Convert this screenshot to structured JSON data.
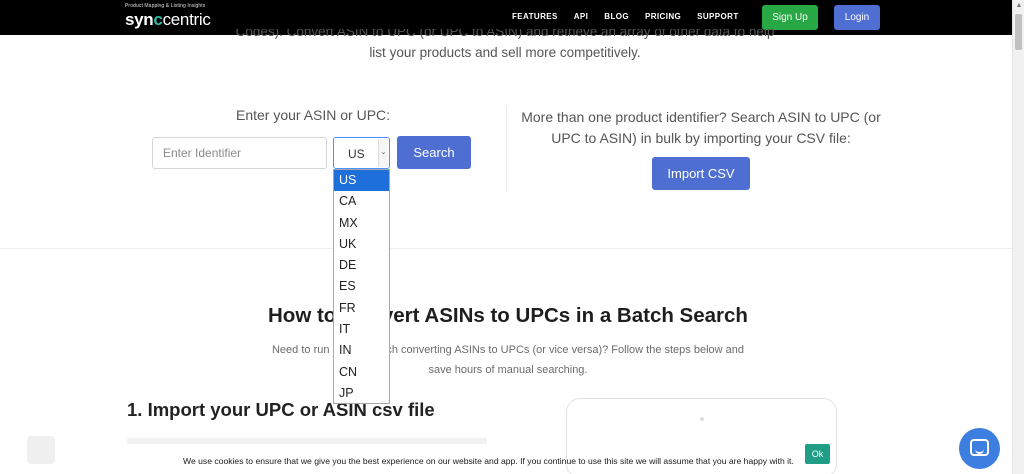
{
  "header": {
    "logo_tagline": "Product Mapping & Listing Insights",
    "logo_text_start": "syn",
    "logo_text_o": "c",
    "logo_text_end": "centric",
    "nav": [
      "FEATURES",
      "API",
      "BLOG",
      "PRICING",
      "SUPPORT"
    ],
    "signup_label": "Sign Up",
    "login_label": "Login"
  },
  "intro": {
    "line1": "Codes). Convert ASIN to UPC (or UPC to ASIN) and retrieve an array of other data to help",
    "line2": "list your products and sell more competitively."
  },
  "search": {
    "label": "Enter your ASIN or UPC:",
    "placeholder": "Enter Identifier",
    "country_value": "US",
    "country_options": [
      "US",
      "CA",
      "MX",
      "UK",
      "DE",
      "ES",
      "FR",
      "IT",
      "IN",
      "CN",
      "JP"
    ],
    "button_label": "Search"
  },
  "bulk": {
    "text": "More than one product identifier? Search ASIN to UPC (or UPC to ASIN) in bulk by importing your CSV file:",
    "button_label": "Import CSV"
  },
  "section": {
    "title": "How to Convert ASINs to UPCs in a Batch Search",
    "desc": "Need to run a bulk search converting ASINs to UPCs (or vice versa)? Follow the steps below and save hours of manual searching.",
    "step1_title": "1. Import your UPC or ASIN csv file"
  },
  "cookie": {
    "text": "We use cookies to ensure that we give you the best experience on our website and app. If you continue to use this site we will assume that you are happy with it.",
    "ok_label": "Ok"
  },
  "colors": {
    "primary": "#4e6fd1",
    "signup": "#28a745",
    "accent_teal": "#2fb9a6",
    "selected_option": "#1e6fd9",
    "cookie_ok": "#1f9d85"
  }
}
